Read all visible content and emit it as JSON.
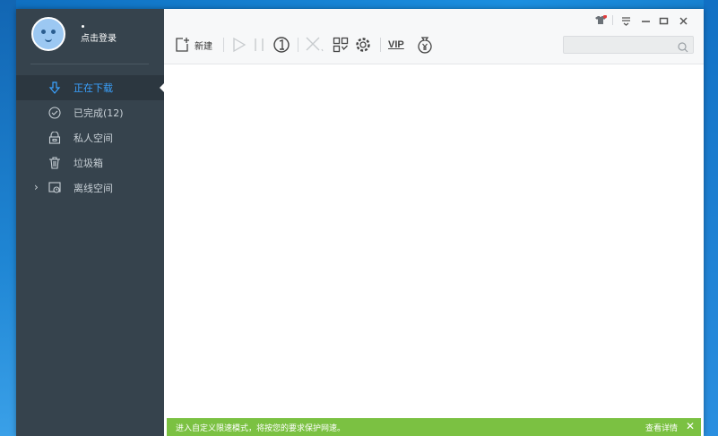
{
  "user": {
    "login_label": "点击登录"
  },
  "nav": {
    "items": [
      {
        "label": "正在下载",
        "icon": "download-arrow-icon",
        "active": true
      },
      {
        "label": "已完成(12)",
        "icon": "check-circle-icon",
        "active": false
      },
      {
        "label": "私人空间",
        "icon": "lock-icon",
        "active": false
      },
      {
        "label": "垃圾箱",
        "icon": "trash-icon",
        "active": false
      },
      {
        "label": "离线空间",
        "icon": "offline-space-icon",
        "active": false,
        "expandable": true
      }
    ]
  },
  "toolbar": {
    "new_label": "新建",
    "vip_label": "VIP"
  },
  "search": {
    "placeholder": ""
  },
  "notice": {
    "text": "进入自定义限速模式，将按您的要求保护网速。",
    "detail_label": "查看详情",
    "close_label": "✕"
  },
  "colors": {
    "sidebar": "#36434d",
    "active_nav": "#3aa2ff",
    "notice_bar": "#7bc142",
    "accent_red": "#e23b3b"
  }
}
